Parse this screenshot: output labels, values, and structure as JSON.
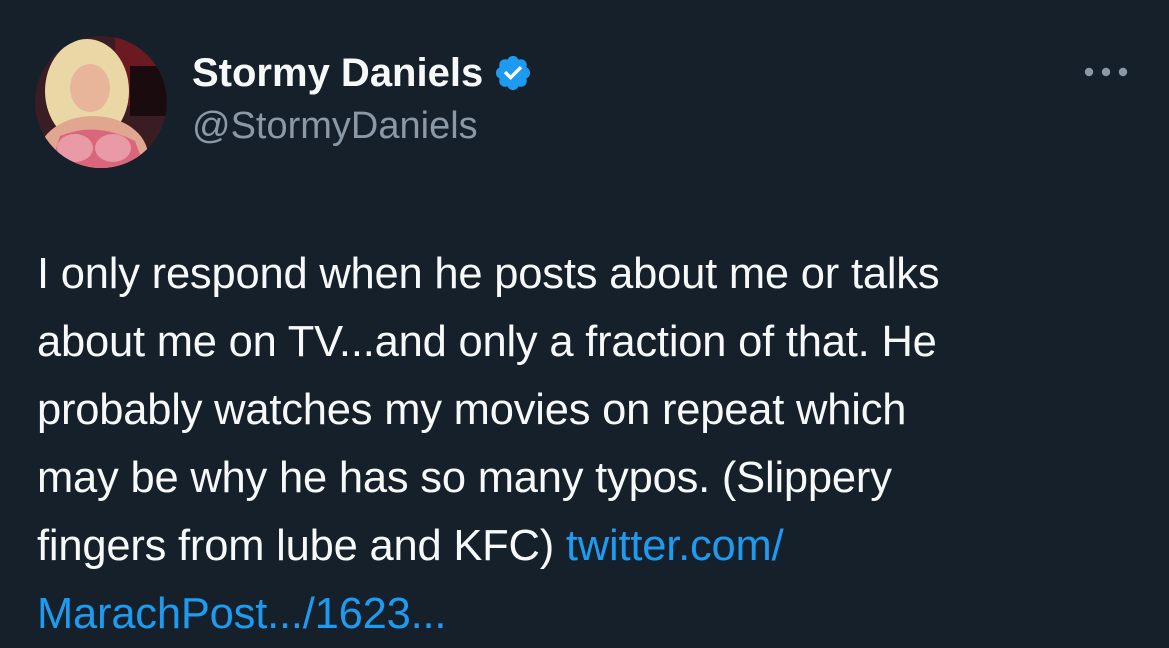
{
  "author": {
    "display_name": "Stormy Daniels",
    "handle": "@StormyDaniels",
    "verified": true
  },
  "icons": {
    "verified": "verified-badge-icon",
    "more": "more-options-icon"
  },
  "tweet": {
    "text": "I only respond when he posts about me or talks\nabout me on TV...and only a fraction of that. He\nprobably watches my movies on repeat which\nmay be why he has so many typos. (Slippery\nfingers from lube and KFC) ",
    "link_text": "twitter.com/",
    "link_continued": "MarachPost.../1623..."
  },
  "colors": {
    "background": "#15202b",
    "text": "#f7f9f9",
    "secondary": "#8b98a5",
    "link": "#1d9bf0",
    "verified": "#1d9bf0"
  }
}
